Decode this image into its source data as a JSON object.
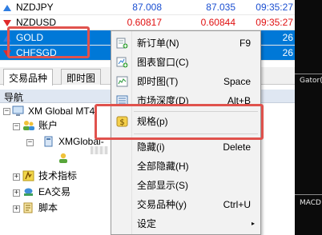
{
  "market_watch": {
    "rows": [
      {
        "symbol": "NZDJPY",
        "bid": "87.008",
        "ask": "87.035",
        "time": "09:35:27",
        "trend": "up",
        "bid_color": "blue",
        "ask_color": "blue",
        "time_color": "blue"
      },
      {
        "symbol": "NZDUSD",
        "bid": "0.60817",
        "ask": "0.60844",
        "time": "09:35:27",
        "trend": "down",
        "bid_color": "red",
        "ask_color": "red",
        "time_color": "red"
      },
      {
        "symbol": "GOLD",
        "bid": "",
        "ask": "",
        "time": "26",
        "trend": "up",
        "selected": true
      },
      {
        "symbol": "CHFSGD",
        "bid": "",
        "ask": "",
        "time": "26",
        "trend": "down"
      }
    ],
    "tabs": [
      "交易品种",
      "即时图"
    ]
  },
  "navigator": {
    "title": "导航",
    "close_glyph": "×",
    "items": {
      "root": "XM Global MT4",
      "accounts": "账户",
      "account": "XMGlobal-",
      "indicators": "技术指标",
      "ea": "EA交易",
      "scripts": "脚本"
    }
  },
  "context_menu": {
    "items": [
      {
        "label": "新订单(N)",
        "shortcut": "F9",
        "icon": "new-order-icon"
      },
      {
        "label": "图表窗口(C)",
        "shortcut": "",
        "icon": "chart-window-icon"
      },
      {
        "label": "即时图(T)",
        "shortcut": "Space",
        "icon": "tick-chart-icon"
      },
      {
        "label": "市场深度(D)",
        "shortcut": "Alt+B",
        "icon": "market-depth-icon"
      },
      {
        "label": "规格(p)",
        "shortcut": "",
        "icon": "specification-icon"
      },
      {
        "label": "隐藏(i)",
        "shortcut": "Delete",
        "icon": ""
      },
      {
        "label": "全部隐藏(H)",
        "shortcut": "",
        "icon": ""
      },
      {
        "label": "全部显示(S)",
        "shortcut": "",
        "icon": ""
      },
      {
        "label": "交易品种(y)",
        "shortcut": "Ctrl+U",
        "icon": ""
      },
      {
        "label": "设定",
        "shortcut": "",
        "icon": "",
        "submenu_glyph": "▸"
      }
    ]
  },
  "chart_labels": {
    "gator": "Gator(",
    "macd": "MACD"
  },
  "colors": {
    "selected_row": "#0078d7",
    "highlight_box": "#e0524d",
    "bid_up": "#1b4fd1",
    "bid_down": "#e01010"
  }
}
